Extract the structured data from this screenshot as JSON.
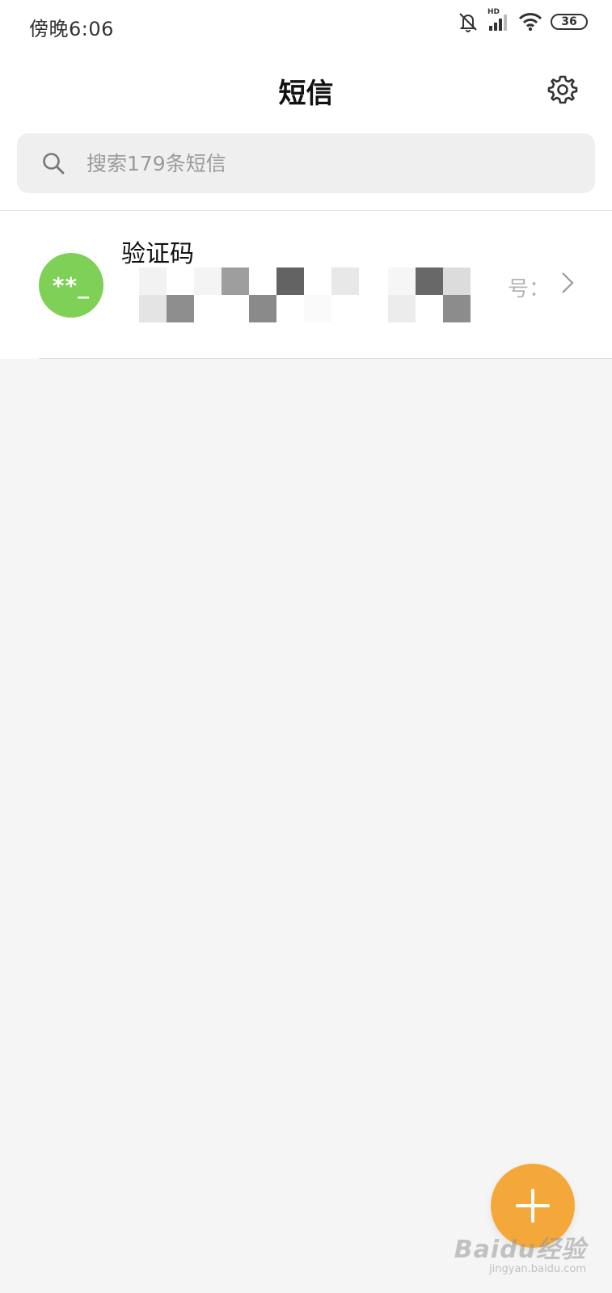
{
  "status_bar": {
    "time": "傍晚6:06",
    "signal_label": "HD",
    "battery_level": "36",
    "icons": [
      "bell-muted-icon",
      "signal-icon",
      "wifi-icon",
      "battery-icon"
    ]
  },
  "header": {
    "title": "短信",
    "settings_icon": "gear-icon"
  },
  "search": {
    "placeholder": "搜索179条短信",
    "value": ""
  },
  "conversations": [
    {
      "name": "验证码",
      "avatar_text": "**_",
      "avatar_color": "#7fd056",
      "preview_visible_fragment": "号：",
      "preview_blurred": true
    }
  ],
  "fab": {
    "icon": "plus-icon",
    "color": "#f5a83a"
  },
  "watermark": {
    "text": "Baidu经验",
    "subtext": "jingyan.baidu.com"
  }
}
